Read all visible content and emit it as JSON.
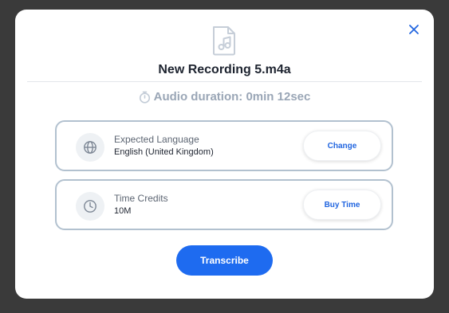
{
  "dialog": {
    "title": "New Recording 5.m4a",
    "duration_text": "Audio duration: 0min 12sec",
    "file_icon": "audio-file-icon",
    "close_icon": "close-icon"
  },
  "language": {
    "label": "Expected Language",
    "value": "English (United Kingdom)",
    "icon": "globe-icon",
    "button_label": "Change"
  },
  "credits": {
    "label": "Time Credits",
    "value": "10M",
    "icon": "clock-icon",
    "button_label": "Buy Time"
  },
  "actions": {
    "primary_label": "Transcribe"
  },
  "colors": {
    "accent": "#1e6bf0",
    "link": "#2266e0",
    "muted": "#9aa6b6",
    "card_border": "#b2c1cf"
  }
}
